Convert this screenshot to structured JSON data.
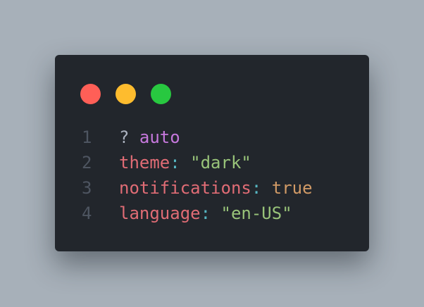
{
  "colors": {
    "background": "#a7b0b9",
    "window": "#22262c",
    "dot_red": "#ff5f57",
    "dot_yellow": "#febc2e",
    "dot_green": "#28c840",
    "line_number": "#4e5561",
    "punct": "#abb2bf",
    "keyword": "#c678dd",
    "key": "#e06c75",
    "colon": "#56b6c2",
    "string": "#98c379",
    "boolean": "#d19a66"
  },
  "window_controls": [
    "close",
    "minimize",
    "maximize"
  ],
  "code": {
    "lines": [
      {
        "number": "1",
        "tokens": [
          {
            "text": "? ",
            "type": "punct"
          },
          {
            "text": "auto",
            "type": "keyword"
          }
        ]
      },
      {
        "number": "2",
        "tokens": [
          {
            "text": "theme",
            "type": "key"
          },
          {
            "text": ": ",
            "type": "colon"
          },
          {
            "text": "\"dark\"",
            "type": "string"
          }
        ]
      },
      {
        "number": "3",
        "tokens": [
          {
            "text": "notifications",
            "type": "key"
          },
          {
            "text": ": ",
            "type": "colon"
          },
          {
            "text": "true",
            "type": "boolean"
          }
        ]
      },
      {
        "number": "4",
        "tokens": [
          {
            "text": "language",
            "type": "key"
          },
          {
            "text": ": ",
            "type": "colon"
          },
          {
            "text": "\"en-US\"",
            "type": "string"
          }
        ]
      }
    ]
  }
}
